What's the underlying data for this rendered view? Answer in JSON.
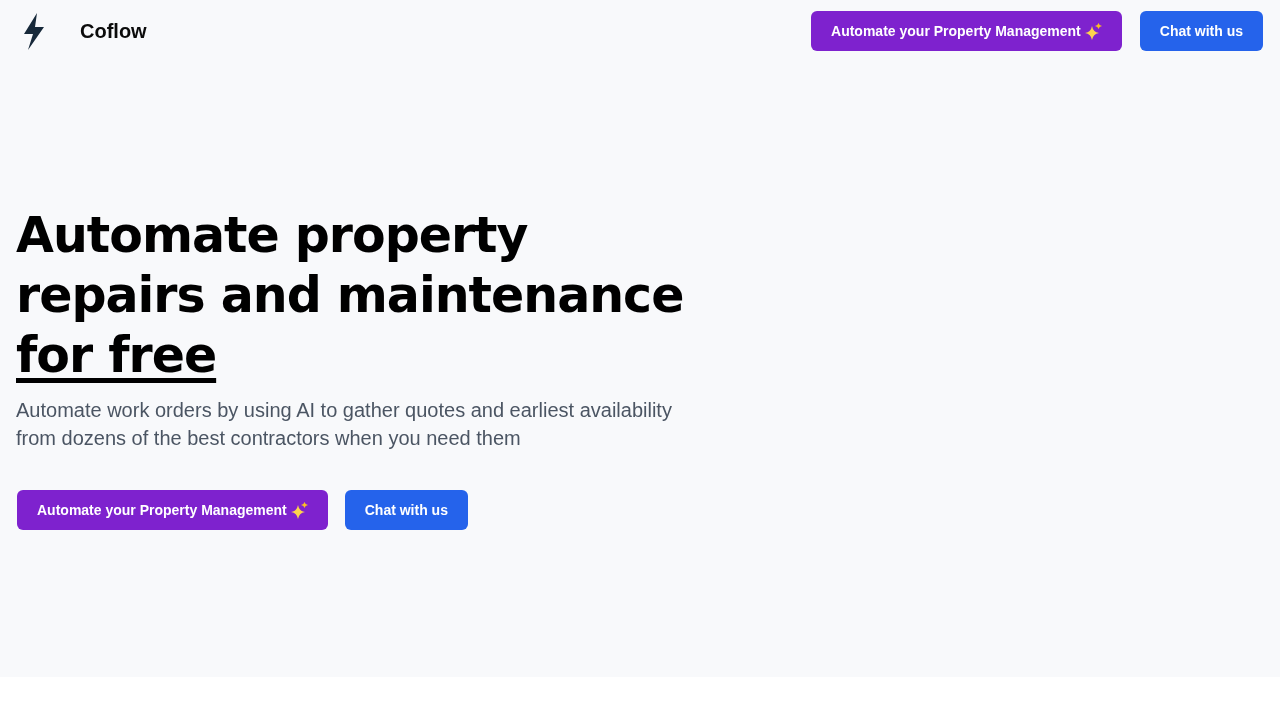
{
  "header": {
    "brand": "Coflow",
    "buttons": [
      {
        "label": "Automate your Property Management",
        "kind": "primary",
        "sparkle": true
      },
      {
        "label": "Chat with us",
        "kind": "secondary",
        "sparkle": false
      }
    ]
  },
  "hero": {
    "heading": {
      "lines": [
        "Automate property",
        "repairs and maintenance"
      ],
      "underlined": "for free"
    },
    "subtitle": "Automate work orders by using AI to gather quotes and earliest availability from dozens of the best contractors when you need them",
    "buttons": [
      {
        "label": "Automate your Property Management",
        "kind": "primary",
        "sparkle": true
      },
      {
        "label": "Chat with us",
        "kind": "secondary",
        "sparkle": false
      }
    ]
  }
}
